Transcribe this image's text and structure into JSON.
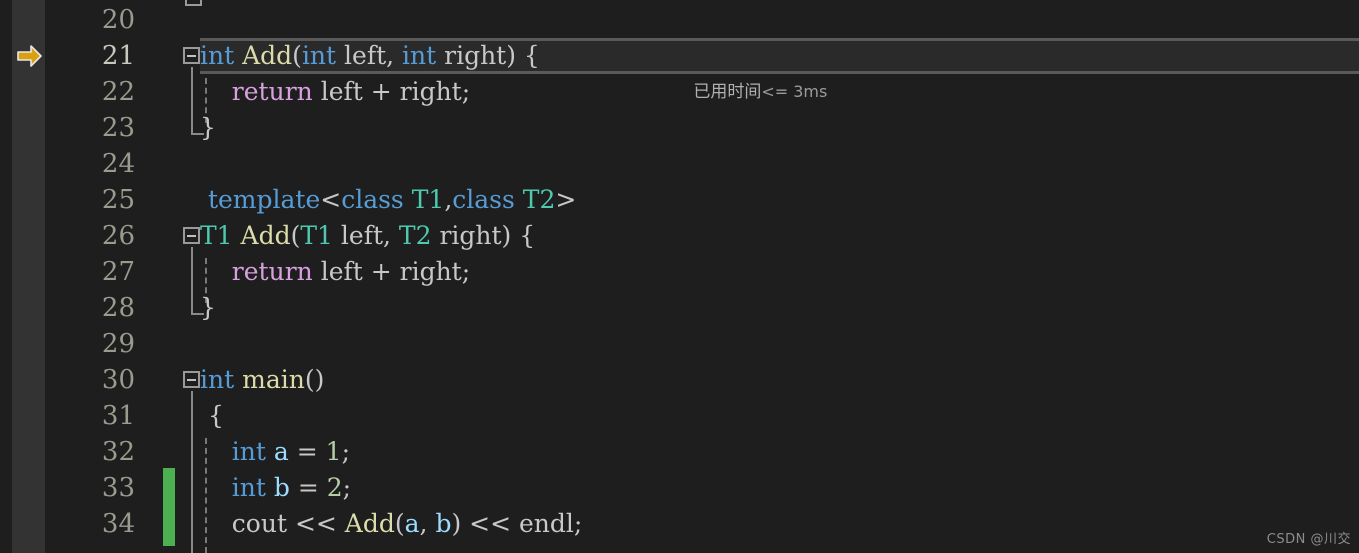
{
  "editor": {
    "language": "cpp",
    "background_color": "#1e1e1e",
    "gutter_color": "#333333",
    "current_line": 21,
    "first_visible_line": 20,
    "last_visible_line": 35
  },
  "gutter": {
    "current_statement_arrow": "current-statement-arrow",
    "arrow_color": "#d9a012",
    "change_bar_color": "#4caf50",
    "changed_lines": [
      33,
      34
    ]
  },
  "codelens": {
    "label_cjk": "已用时间",
    "label_expr": "<= 3ms",
    "full_text": "已用时间 <= 3ms"
  },
  "lines": [
    {
      "number": "20",
      "tokens": []
    },
    {
      "number": "21",
      "fold": "collapse",
      "tokens": [
        {
          "t": "int",
          "c": "kw"
        },
        {
          "t": " ",
          "c": "plain"
        },
        {
          "t": "Add",
          "c": "fn"
        },
        {
          "t": "(",
          "c": "punc"
        },
        {
          "t": "int",
          "c": "kw"
        },
        {
          "t": " left, ",
          "c": "plain"
        },
        {
          "t": "int",
          "c": "kw"
        },
        {
          "t": " right) { ",
          "c": "plain"
        }
      ]
    },
    {
      "number": "22",
      "tokens": [
        {
          "t": "    ",
          "c": "plain"
        },
        {
          "t": "return",
          "c": "kw2"
        },
        {
          "t": " left + right;",
          "c": "plain"
        }
      ]
    },
    {
      "number": "23",
      "tokens": [
        {
          "t": "}",
          "c": "plain"
        }
      ]
    },
    {
      "number": "24",
      "tokens": []
    },
    {
      "number": "25",
      "tokens": [
        {
          "t": " ",
          "c": "plain"
        },
        {
          "t": "template",
          "c": "kw"
        },
        {
          "t": "<",
          "c": "plain"
        },
        {
          "t": "class",
          "c": "kw"
        },
        {
          "t": " ",
          "c": "plain"
        },
        {
          "t": "T1",
          "c": "type"
        },
        {
          "t": ",",
          "c": "plain"
        },
        {
          "t": "class",
          "c": "kw"
        },
        {
          "t": " ",
          "c": "plain"
        },
        {
          "t": "T2",
          "c": "type"
        },
        {
          "t": ">",
          "c": "plain"
        }
      ]
    },
    {
      "number": "26",
      "fold": "collapse",
      "tokens": [
        {
          "t": "T1",
          "c": "type"
        },
        {
          "t": " ",
          "c": "plain"
        },
        {
          "t": "Add",
          "c": "fn"
        },
        {
          "t": "(",
          "c": "punc"
        },
        {
          "t": "T1",
          "c": "type"
        },
        {
          "t": " left, ",
          "c": "plain"
        },
        {
          "t": "T2",
          "c": "type"
        },
        {
          "t": " right) {",
          "c": "plain"
        }
      ]
    },
    {
      "number": "27",
      "tokens": [
        {
          "t": "    ",
          "c": "plain"
        },
        {
          "t": "return",
          "c": "kw2"
        },
        {
          "t": " left + right;",
          "c": "plain"
        }
      ]
    },
    {
      "number": "28",
      "tokens": [
        {
          "t": "}",
          "c": "plain"
        }
      ]
    },
    {
      "number": "29",
      "tokens": []
    },
    {
      "number": "30",
      "fold": "collapse",
      "tokens": [
        {
          "t": "int",
          "c": "kw"
        },
        {
          "t": " ",
          "c": "plain"
        },
        {
          "t": "main",
          "c": "fn"
        },
        {
          "t": "()",
          "c": "punc"
        }
      ]
    },
    {
      "number": "31",
      "tokens": [
        {
          "t": " {",
          "c": "plain"
        }
      ]
    },
    {
      "number": "32",
      "tokens": [
        {
          "t": "    ",
          "c": "plain"
        },
        {
          "t": "int",
          "c": "kw"
        },
        {
          "t": " ",
          "c": "plain"
        },
        {
          "t": "a",
          "c": "var"
        },
        {
          "t": " = ",
          "c": "plain"
        },
        {
          "t": "1",
          "c": "num"
        },
        {
          "t": ";",
          "c": "plain"
        }
      ]
    },
    {
      "number": "33",
      "tokens": [
        {
          "t": "    ",
          "c": "plain"
        },
        {
          "t": "int",
          "c": "kw"
        },
        {
          "t": " ",
          "c": "plain"
        },
        {
          "t": "b",
          "c": "var"
        },
        {
          "t": " = ",
          "c": "plain"
        },
        {
          "t": "2",
          "c": "num"
        },
        {
          "t": ";",
          "c": "plain"
        }
      ]
    },
    {
      "number": "34",
      "tokens": [
        {
          "t": "    ",
          "c": "plain"
        },
        {
          "t": "cout",
          "c": "plain"
        },
        {
          "t": " << ",
          "c": "plain"
        },
        {
          "t": "Add",
          "c": "fn"
        },
        {
          "t": "(",
          "c": "punc"
        },
        {
          "t": "a",
          "c": "var"
        },
        {
          "t": ", ",
          "c": "plain"
        },
        {
          "t": "b",
          "c": "var"
        },
        {
          "t": ")",
          "c": "punc"
        },
        {
          "t": " << ",
          "c": "plain"
        },
        {
          "t": "endl",
          "c": "plain"
        },
        {
          "t": ";",
          "c": "plain"
        }
      ]
    }
  ],
  "watermark": {
    "text": "CSDN @川交"
  }
}
